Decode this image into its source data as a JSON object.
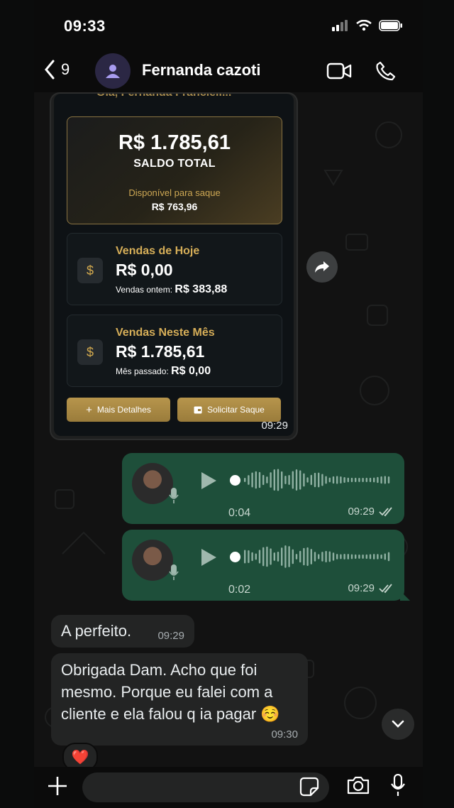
{
  "status": {
    "time": "09:33"
  },
  "header": {
    "back_count": "9",
    "contact_name": "Fernanda cazoti"
  },
  "image_message": {
    "cut_title": "Olá, Fernanda Francieli...",
    "saldo_amount": "R$ 1.785,61",
    "saldo_label": "SALDO TOTAL",
    "available_label": "Disponível para saque",
    "available_amount": "R$ 763,96",
    "today": {
      "title": "Vendas de Hoje",
      "value": "R$ 0,00",
      "sub_label": "Vendas ontem:",
      "sub_value": "R$ 383,88",
      "icon": "$"
    },
    "month": {
      "title": "Vendas Neste Mês",
      "value": "R$ 1.785,61",
      "sub_label": "Mês passado:",
      "sub_value": "R$ 0,00",
      "icon": "$"
    },
    "details_button": "Mais Detalhes",
    "withdraw_button": "Solicitar Saque",
    "time": "09:29"
  },
  "voice_messages": [
    {
      "duration": "0:04",
      "time": "09:29"
    },
    {
      "duration": "0:02",
      "time": "09:29"
    }
  ],
  "text_messages": [
    {
      "text": "A perfeito.",
      "time": "09:29"
    },
    {
      "text": "Obrigada Dam. Acho que foi mesmo. Porque eu falei com a cliente e ela falou q ia pagar ☺️",
      "time": "09:30"
    }
  ],
  "reaction": "❤️",
  "colors": {
    "outgoing": "#1e4f3a",
    "incoming": "#232424",
    "gold": "#c9a55a"
  }
}
